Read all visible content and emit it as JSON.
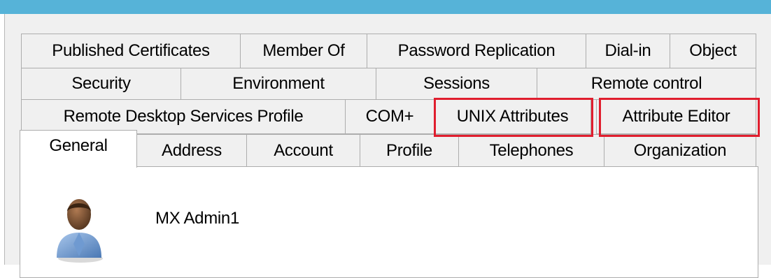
{
  "tabs": {
    "row1": [
      "Published Certificates",
      "Member Of",
      "Password Replication",
      "Dial-in",
      "Object"
    ],
    "row2": [
      "Security",
      "Environment",
      "Sessions",
      "Remote control"
    ],
    "row3": [
      "Remote Desktop Services Profile",
      "COM+",
      "UNIX Attributes",
      "Attribute Editor"
    ],
    "row4": [
      "General",
      "Address",
      "Account",
      "Profile",
      "Telephones",
      "Organization"
    ]
  },
  "selected_tab": "General",
  "highlighted_tabs": [
    "UNIX Attributes",
    "Attribute Editor"
  ],
  "general": {
    "user_icon": "user-icon",
    "display_name": "MX Admin1"
  },
  "colors": {
    "title_bar": "#56b3d8",
    "highlight": "#e01e2e",
    "dialog_bg": "#f0f0f0"
  }
}
